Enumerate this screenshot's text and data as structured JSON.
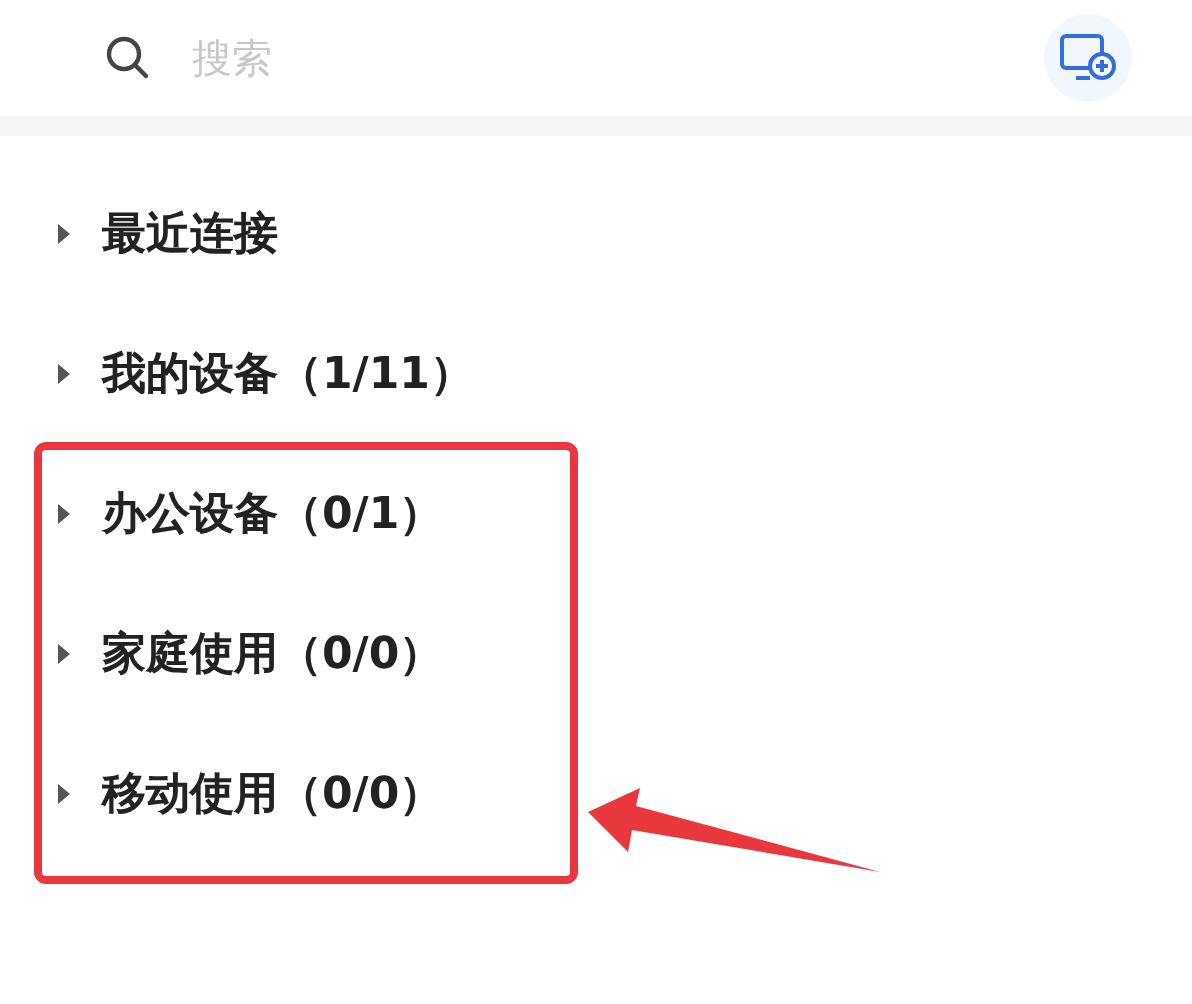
{
  "search": {
    "placeholder": "搜索"
  },
  "groups": [
    {
      "label": "最近连接",
      "expanded": false
    },
    {
      "label": "我的设备（1/11）",
      "expanded": false
    },
    {
      "label": "办公设备（0/1）",
      "expanded": false
    },
    {
      "label": "家庭使用（0/0）",
      "expanded": false
    },
    {
      "label": "移动使用（0/0）",
      "expanded": false
    }
  ]
}
